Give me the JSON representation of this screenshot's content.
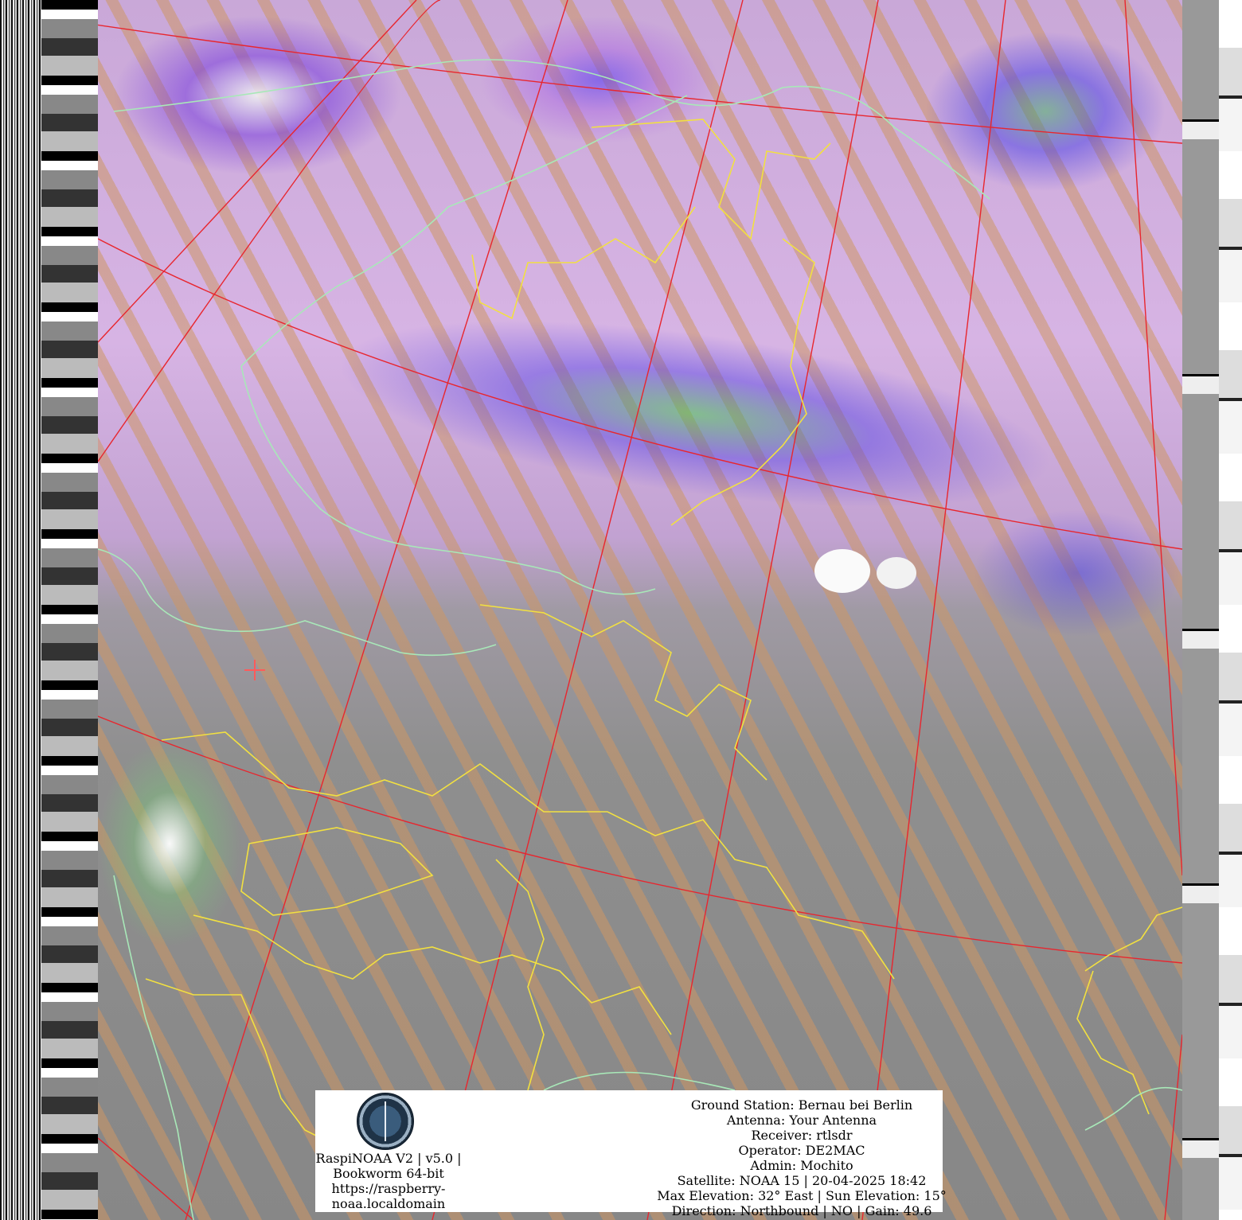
{
  "info_panel": {
    "software_lines": [
      "RaspiNOAA V2 | v5.0 |",
      "Bookworm 64-bit",
      "https://raspberry-",
      "noaa.localdomain"
    ],
    "ground_station": "Ground Station: Bernau bei Berlin",
    "antenna": "Antenna: Your Antenna",
    "receiver": "Receiver: rtlsdr",
    "operator": "Operator: DE2MAC",
    "admin": "Admin: Mochito",
    "satellite": "Satellite: NOAA 15 | 20-04-2025 18:42",
    "elevation": "Max Elevation: 32° East | Sun Elevation: 15°",
    "direction": "Direction: Northbound | NO | Gain: 49.6"
  },
  "colors": {
    "graticule": "#e8262e",
    "borders": "#f2e040",
    "coastlines": "#a8e8b8",
    "station_marker": "#ff5a5a"
  },
  "icons": {
    "logo": "station-logo-icon",
    "marker": "ground-station-marker-icon"
  }
}
